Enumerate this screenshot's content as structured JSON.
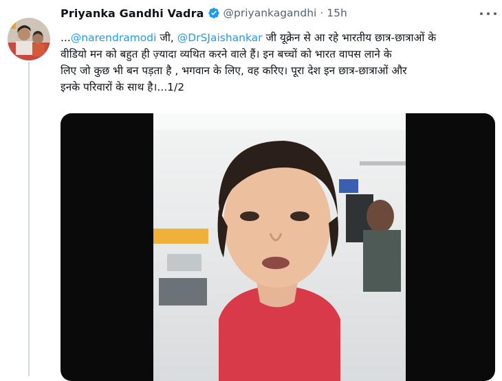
{
  "tweet": {
    "display_name": "Priyanka Gandhi Vadra",
    "handle": "@priyankagandhi",
    "separator": "·",
    "time": "15h",
    "text": {
      "line1": {
        "prefix": "...",
        "mention1": "@narendramodi",
        "mid": " जी, ",
        "mention2": "@DrSJaishankar",
        "suffix": " जी यूक्रेन से आ रहे भारतीय छात्र-छात्राओं के"
      },
      "line2": "वीडियो मन को बहुत ही ज़्यादा व्यथित करने वाले हैं। इन बच्चों को भारत वापस लाने के",
      "line3": "लिए जो कुछ भी बन पड़ता है , भगवान के लिए, वह करिए। पूरा देश इन छात्र-छात्राओं और",
      "line4": "इनके परिवारों के साथ है।...1/2"
    }
  },
  "colors": {
    "link": "#1d9bf0",
    "verified": "#1d9bf0",
    "secondary_text": "#536471",
    "thread_line": "#cfd9de",
    "video_letterbox": "#0a0a0a",
    "shirt": "#d83a4a"
  },
  "icons": {
    "verified": "verified-badge-icon",
    "more": "more-dots-icon"
  }
}
